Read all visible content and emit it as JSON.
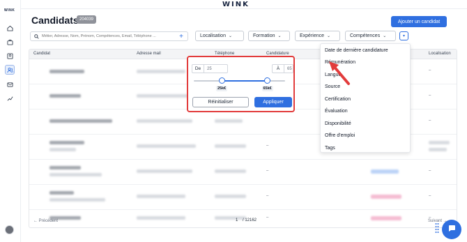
{
  "app": {
    "brand": "WINK",
    "side_logo": "WINK"
  },
  "header": {
    "title": "Candidats",
    "count": "204039",
    "add_button": "Ajouter un candidat"
  },
  "search": {
    "placeholder": "Métier, Adresse, Nom, Prénom, Compétences, Email, Téléphone ..."
  },
  "filters": {
    "localisation": "Localisation",
    "formation": "Formation",
    "experience": "Expérience",
    "competences": "Compétences"
  },
  "table": {
    "columns": [
      "Candidat",
      "Adresse mail",
      "Téléphone",
      "Candidature",
      "Localisation"
    ],
    "rows": [
      {
        "name": "",
        "sub": "",
        "loc": "–",
        "dash": ""
      },
      {
        "name": "",
        "sub": "",
        "loc": "–",
        "dash": ""
      },
      {
        "name": "",
        "sub": "",
        "loc": "–",
        "dash": ""
      },
      {
        "name": "Thomas RICCHI",
        "sub": "Agent de sécurité",
        "loc": "",
        "dash": "–"
      },
      {
        "name": "Maëva CARRE",
        "sub": "",
        "loc": "–",
        "dash": "–"
      },
      {
        "name": "",
        "sub": "",
        "loc": "–",
        "dash": "–"
      },
      {
        "name": "",
        "sub": "",
        "loc": "–",
        "dash": "–"
      }
    ]
  },
  "pagination": {
    "prev": "← Précédent",
    "current": "1",
    "total": "/ 12162",
    "next": "Suivant →"
  },
  "dropdown": {
    "items": [
      "Date de dernière candidature",
      "Rémunération",
      "Langue",
      "Source",
      "Certification",
      "Évaluation",
      "Disponibilité",
      "Offre d'emploi",
      "Tags"
    ]
  },
  "salary_filter": {
    "from_label": "De",
    "from_value": "25",
    "to_label": "À",
    "to_value": "65",
    "min_label": "25k€",
    "max_label": "65k€",
    "reset": "Réinitialiser",
    "apply": "Appliquer",
    "range_fraction": [
      0.0,
      0.5
    ]
  },
  "colors": {
    "accent": "#2f6fe0",
    "highlight": "#e23b3b"
  },
  "icons": [
    "home-icon",
    "briefcase-icon",
    "candidates-icon",
    "users-icon",
    "mail-icon",
    "chart-icon",
    "search-icon",
    "chevron-down-icon",
    "chat-icon"
  ]
}
